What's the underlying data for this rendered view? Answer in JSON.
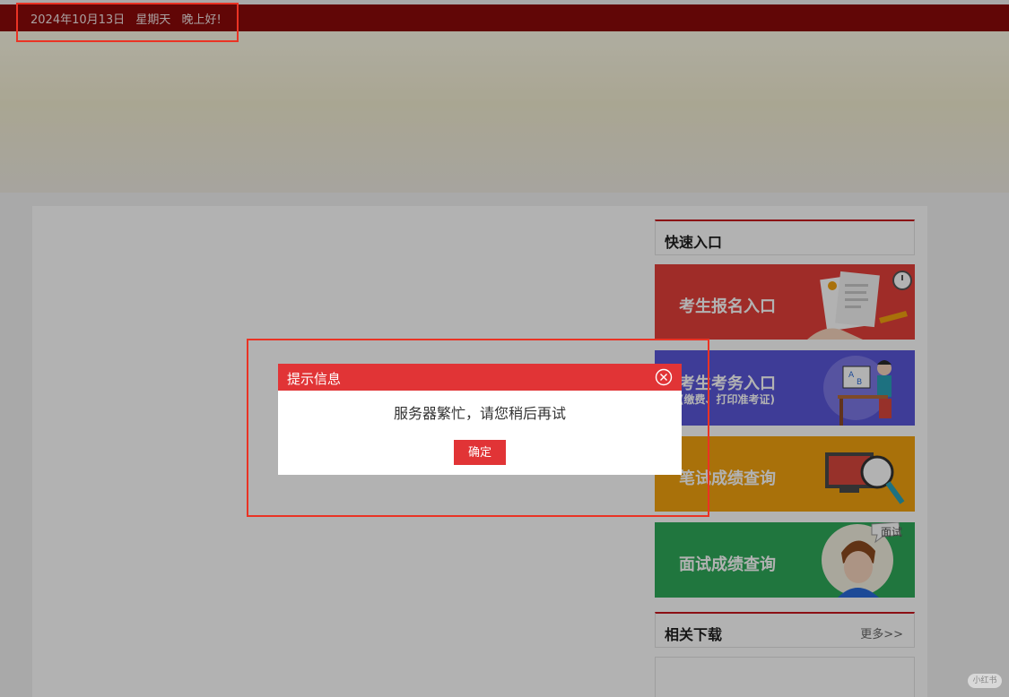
{
  "topbar": {
    "date": "2024年10月13日",
    "weekday": "星期天",
    "greeting": "晚上好!"
  },
  "quick_entry": {
    "title": "快速入口",
    "items": [
      {
        "label": "考生报名入口",
        "sub": "",
        "color": "#e4403a"
      },
      {
        "label": "考生考务入口",
        "sub": "(缴费、打印准考证)",
        "color": "#5a56d8"
      },
      {
        "label": "笔试成绩查询",
        "sub": "",
        "color": "#f2a20f"
      },
      {
        "label": "面试成绩查询",
        "sub": "",
        "color": "#2ea95a",
        "badge": "面试"
      }
    ]
  },
  "downloads": {
    "title": "相关下载",
    "more": "更多>>"
  },
  "dialog": {
    "title": "提示信息",
    "message": "服务器繁忙，请您稍后再试",
    "ok_label": "确定"
  },
  "watermark": "小红书",
  "colors": {
    "topbar": "#8b0a0a",
    "accent_red": "#e13436",
    "highlight_box": "#ea3324"
  }
}
